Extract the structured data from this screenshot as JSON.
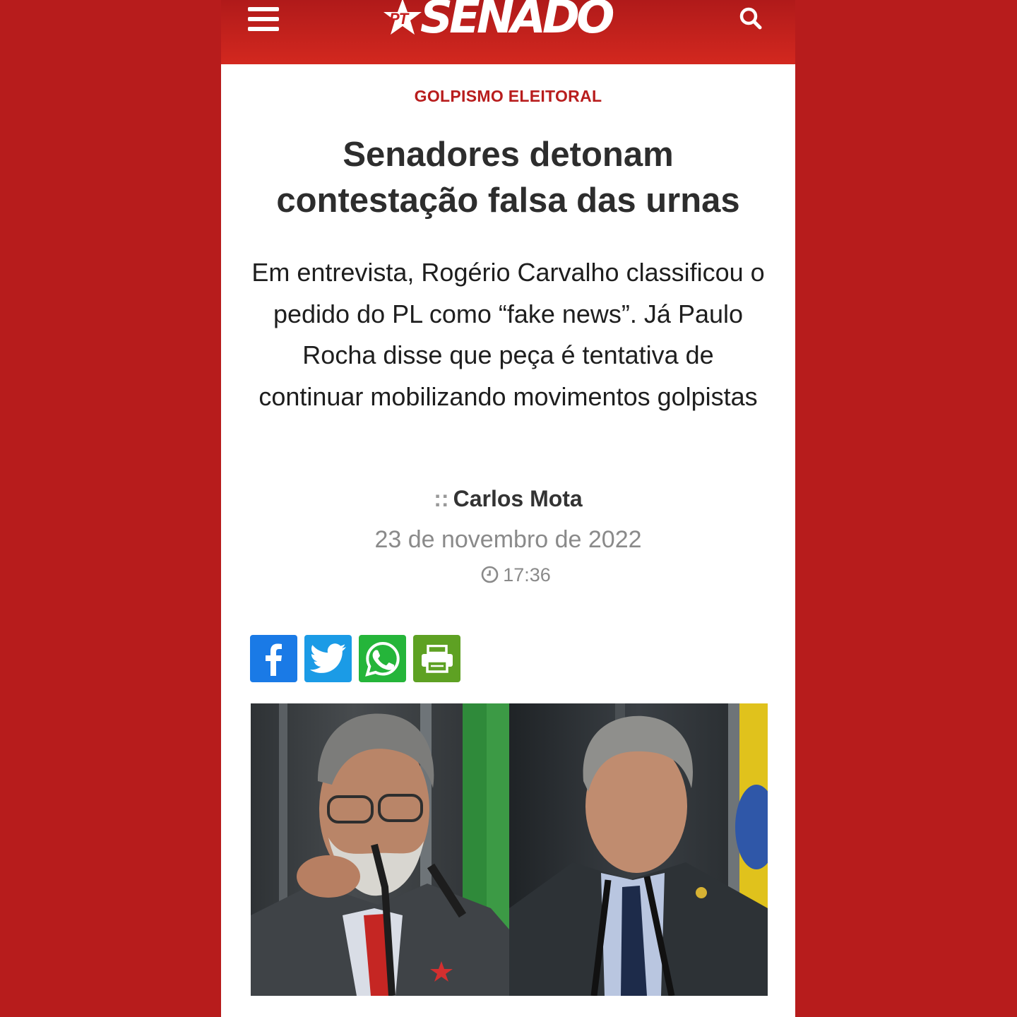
{
  "colors": {
    "page_background": "#b71c1c",
    "header_red": "#c9231c",
    "kicker_red": "#b81d1d",
    "facebook": "#1a7ae6",
    "twitter": "#1b9be6",
    "whatsapp": "#25b53a",
    "print": "#5ea123"
  },
  "header": {
    "logo_badge": "PT",
    "logo_text": "SENADO",
    "menu_icon": "hamburger-menu-icon",
    "search_icon": "search-icon"
  },
  "article": {
    "kicker": "GOLPISMO ELEITORAL",
    "headline": "Senadores detonam contestação falsa das urnas",
    "summary": "Em entrevista, Rogério Carvalho classificou o pedido do PL como “fake news”. Já Paulo Rocha disse que peça é tentativa de continuar mobilizando movimentos golpistas",
    "author_prefix": "::",
    "author": "Carlos Mota",
    "date": "23 de novembro de 2022",
    "time": "17:36"
  },
  "share": [
    {
      "icon": "facebook-icon"
    },
    {
      "icon": "twitter-icon"
    },
    {
      "icon": "whatsapp-icon"
    },
    {
      "icon": "print-icon"
    }
  ],
  "photo": {
    "left_subject": "senator-portrait-left",
    "right_subject": "senator-portrait-right"
  }
}
